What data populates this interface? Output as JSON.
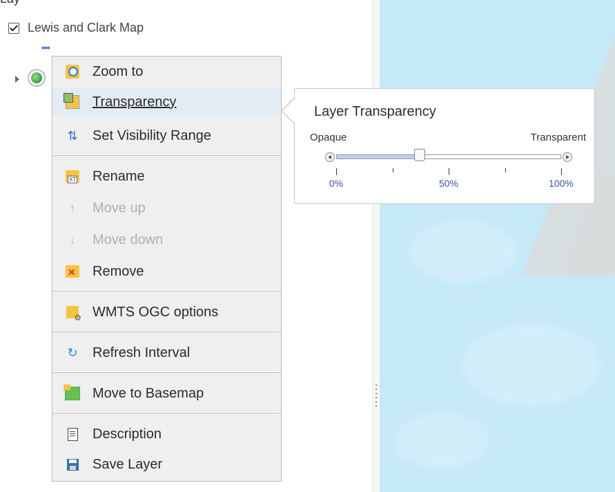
{
  "panel": {
    "top_text": "Lay",
    "layer_name": "Lewis and Clark Map",
    "layer_checked": true,
    "options_ellipsis": "•••"
  },
  "context_menu": {
    "items": [
      {
        "label": "Zoom to",
        "icon": "zoom-to-icon",
        "enabled": true
      },
      {
        "label": "Transparency",
        "icon": "transparency-icon",
        "enabled": true,
        "active": true
      },
      {
        "label": "Set Visibility Range",
        "icon": "visibility-range-icon",
        "enabled": true
      },
      {
        "label": "Rename",
        "icon": "rename-icon",
        "enabled": true
      },
      {
        "label": "Move up",
        "icon": "arrow-up-icon",
        "enabled": false
      },
      {
        "label": "Move down",
        "icon": "arrow-down-icon",
        "enabled": false
      },
      {
        "label": "Remove",
        "icon": "remove-icon",
        "enabled": true
      },
      {
        "label": "WMTS OGC options",
        "icon": "wmts-options-icon",
        "enabled": true
      },
      {
        "label": "Refresh Interval",
        "icon": "refresh-icon",
        "enabled": true
      },
      {
        "label": "Move to Basemap",
        "icon": "move-to-basemap-icon",
        "enabled": true
      },
      {
        "label": "Description",
        "icon": "description-icon",
        "enabled": true
      },
      {
        "label": "Save Layer",
        "icon": "save-icon",
        "enabled": true
      }
    ]
  },
  "transparency_popup": {
    "title": "Layer Transparency",
    "min_label": "Opaque",
    "max_label": "Transparent",
    "value_percent": 37,
    "ticks": [
      {
        "label": "0%"
      },
      {
        "label": ""
      },
      {
        "label": "50%"
      },
      {
        "label": ""
      },
      {
        "label": "100%"
      }
    ]
  },
  "colors": {
    "accent": "#3b7dc4",
    "map_water": "#c6e9f8",
    "menu_bg": "#efefef",
    "menu_active": "#e3ecf5"
  }
}
